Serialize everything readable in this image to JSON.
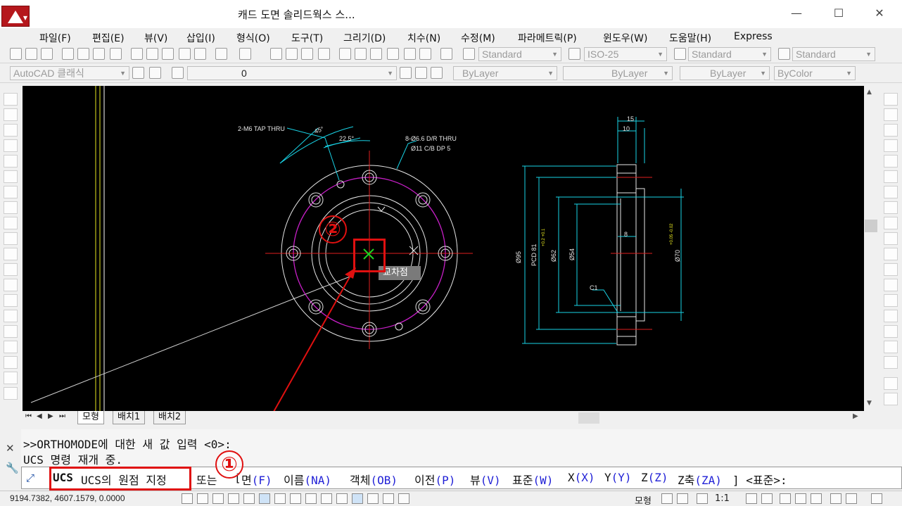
{
  "window": {
    "title": "캐드 도면 솔리드웍스 스...",
    "minimize_glyph": "—",
    "maximize_glyph": "☐",
    "close_glyph": "✕"
  },
  "menu": [
    "파일(F)",
    "편집(E)",
    "뷰(V)",
    "삽입(I)",
    "형식(O)",
    "도구(T)",
    "그리기(D)",
    "치수(N)",
    "수정(M)",
    "파라메트릭(P)",
    "윈도우(W)",
    "도움말(H)",
    "Express"
  ],
  "mdi_controls": [
    "_",
    "⧉",
    "✕"
  ],
  "styles_toolbar": {
    "text_style": "Standard",
    "dim_style": "ISO-25",
    "table_style": "Standard",
    "mleader_style": "Standard"
  },
  "workspace": "AutoCAD 클래식",
  "layer": "0",
  "properties": {
    "color": "ByLayer",
    "linetype": "ByLayer",
    "lineweight": "ByLayer",
    "plotstyle": "ByColor"
  },
  "drawing": {
    "annotations": {
      "tap": "2-M6 TAP THRU",
      "angle1": "45°",
      "angle2": "22.5°",
      "holes1": "8-Ø6.6 D/R THRU",
      "holes2": "Ø11 C/B DP 5",
      "dim15": "15",
      "dim10": "10",
      "dim8": "8",
      "d95": "Ø95",
      "pcd": "PCD 81",
      "d62": "Ø62",
      "d54": "Ø54",
      "d70": "Ø70",
      "c1": "C1",
      "tol1": "+0.2\n+0.1",
      "tol2": "+0.05\n-0.02"
    },
    "snap_tooltip": "교차점",
    "marker1": "①",
    "marker2": "②"
  },
  "tabs": {
    "nav": [
      "⏮",
      "◀",
      "▶",
      "⏭"
    ],
    "items": [
      "모형",
      "배치1",
      "배치2"
    ]
  },
  "command": {
    "history": [
      ">>ORTHOMODE에 대한 새 값 입력 <0>:",
      "UCS 명령 재개 중."
    ],
    "prefix": "UCS",
    "prompt": "UCS의 원점 지정",
    "or": "또는",
    "open_bracket": "[",
    "options": [
      {
        "label": "면",
        "key": "(F)"
      },
      {
        "label": "이름",
        "key": "(NA)"
      },
      {
        "label": "객체",
        "key": "(OB)"
      },
      {
        "label": "이전",
        "key": "(P)"
      },
      {
        "label": "뷰",
        "key": "(V)"
      },
      {
        "label": "표준",
        "key": "(W)"
      },
      {
        "label": "X",
        "key": "(X)"
      },
      {
        "label": "Y",
        "key": "(Y)"
      },
      {
        "label": "Z",
        "key": "(Z)"
      },
      {
        "label": "Z축",
        "key": "(ZA)"
      }
    ],
    "close": "] <표준>:"
  },
  "status": {
    "coordinates": "9194.7382, 4607.1579, 0.0000",
    "model": "모형",
    "scale": "1:1"
  },
  "colors": {
    "accent_red": "#e01010",
    "cad_bg": "#000000",
    "cyan": "#19d3e6",
    "magenta": "#c71fc7",
    "red_center": "#e01e1e",
    "yellow": "#e8e820"
  }
}
